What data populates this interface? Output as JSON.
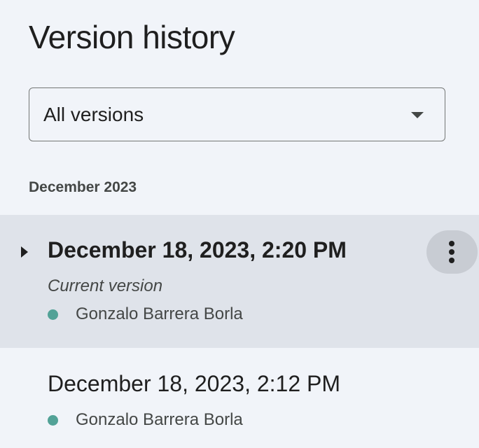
{
  "panel": {
    "title": "Version history",
    "filter": {
      "selected": "All versions",
      "icon": "caret-down-icon"
    }
  },
  "groups": [
    {
      "label": "December 2023",
      "versions": [
        {
          "date": "December 18, 2023, 2:20 PM",
          "note": "Current version",
          "author": "Gonzalo Barrera Borla",
          "author_color": "#52a297",
          "selected": true
        },
        {
          "date": "December 18, 2023, 2:12 PM",
          "author": "Gonzalo Barrera Borla",
          "author_color": "#52a297",
          "selected": false
        }
      ]
    }
  ],
  "colors": {
    "background": "#f1f4f9",
    "selected_row": "#dfe3ea",
    "more_button": "#c8ccd3"
  }
}
